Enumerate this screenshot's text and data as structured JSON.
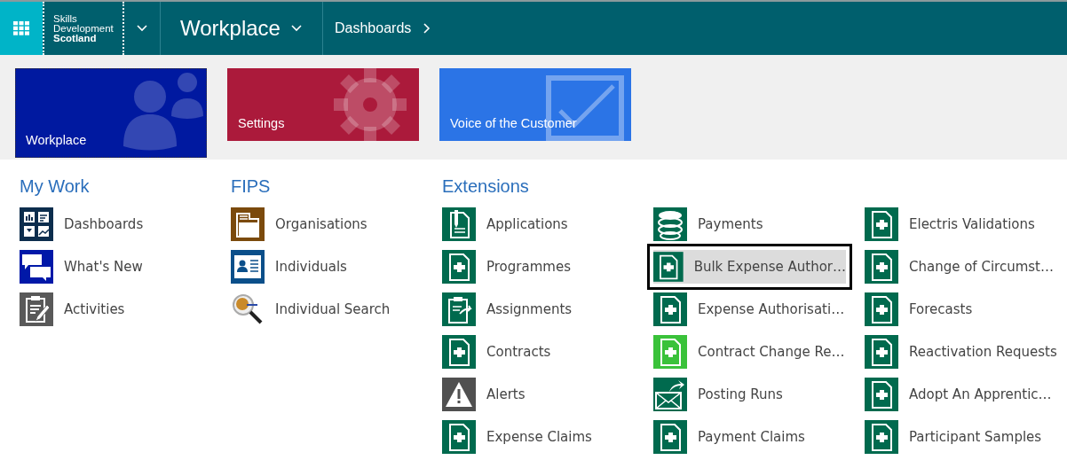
{
  "nav": {
    "logo": [
      "Skills",
      "Development",
      "Scotland"
    ],
    "area": "Workplace",
    "breadcrumb": "Dashboards"
  },
  "tiles": [
    {
      "label": "Workplace",
      "color": "#0019a0",
      "kind": "people",
      "focused": true
    },
    {
      "label": "Settings",
      "color": "#ab1a3b",
      "kind": "gear",
      "focused": false
    },
    {
      "label": "Voice of the Customer",
      "color": "#2b74e6",
      "kind": "check",
      "focused": false
    }
  ],
  "sections": [
    {
      "title": "My Work",
      "columns": [
        [
          {
            "label": "Dashboards",
            "kind": "dashboard",
            "color": "#0c2d4d",
            "selected": false
          },
          {
            "label": "What's New",
            "kind": "chat",
            "color": "#0018a8",
            "selected": false
          },
          {
            "label": "Activities",
            "kind": "clipboard",
            "color": "#595959",
            "selected": false
          }
        ]
      ]
    },
    {
      "title": "FIPS",
      "columns": [
        [
          {
            "label": "Organisations",
            "kind": "folder",
            "color": "#7b4a0c",
            "selected": false
          },
          {
            "label": "Individuals",
            "kind": "idcard",
            "color": "#0b4f8a",
            "selected": false
          },
          {
            "label": "Individual Search",
            "kind": "search",
            "color": "#c98a2a",
            "selected": false
          }
        ]
      ]
    },
    {
      "title": "Extensions",
      "columns": [
        [
          {
            "label": "Applications",
            "kind": "document",
            "color": "#006a4e",
            "selected": false
          },
          {
            "label": "Programmes",
            "kind": "puzzle",
            "color": "#006a4e",
            "selected": false
          },
          {
            "label": "Assignments",
            "kind": "assign",
            "color": "#006a4e",
            "selected": false
          },
          {
            "label": "Contracts",
            "kind": "puzzle",
            "color": "#006a4e",
            "selected": false
          },
          {
            "label": "Alerts",
            "kind": "alert",
            "color": "#505050",
            "selected": false
          },
          {
            "label": "Expense Claims",
            "kind": "puzzle",
            "color": "#006a4e",
            "selected": false
          }
        ],
        [
          {
            "label": "Payments",
            "kind": "coins",
            "color": "#006a4e",
            "selected": false
          },
          {
            "label": "Bulk Expense Author…",
            "kind": "puzzle",
            "color": "#006a4e",
            "selected": true
          },
          {
            "label": "Expense Authorisati…",
            "kind": "puzzle",
            "color": "#006a4e",
            "selected": false
          },
          {
            "label": "Contract Change Re…",
            "kind": "puzzle",
            "color": "#3ac23a",
            "selected": false
          },
          {
            "label": "Posting Runs",
            "kind": "mail",
            "color": "#006a4e",
            "selected": false
          },
          {
            "label": "Payment Claims",
            "kind": "puzzle",
            "color": "#006a4e",
            "selected": false
          }
        ],
        [
          {
            "label": "Electris Validations",
            "kind": "puzzle",
            "color": "#006a4e",
            "selected": false
          },
          {
            "label": "Change of Circumst…",
            "kind": "puzzle",
            "color": "#006a4e",
            "selected": false
          },
          {
            "label": "Forecasts",
            "kind": "puzzle",
            "color": "#006a4e",
            "selected": false
          },
          {
            "label": "Reactivation Requests",
            "kind": "puzzle",
            "color": "#006a4e",
            "selected": false
          },
          {
            "label": "Adopt An Apprentic…",
            "kind": "puzzle",
            "color": "#006a4e",
            "selected": false
          },
          {
            "label": "Participant Samples",
            "kind": "puzzle",
            "color": "#006a4e",
            "selected": false
          }
        ]
      ]
    }
  ]
}
